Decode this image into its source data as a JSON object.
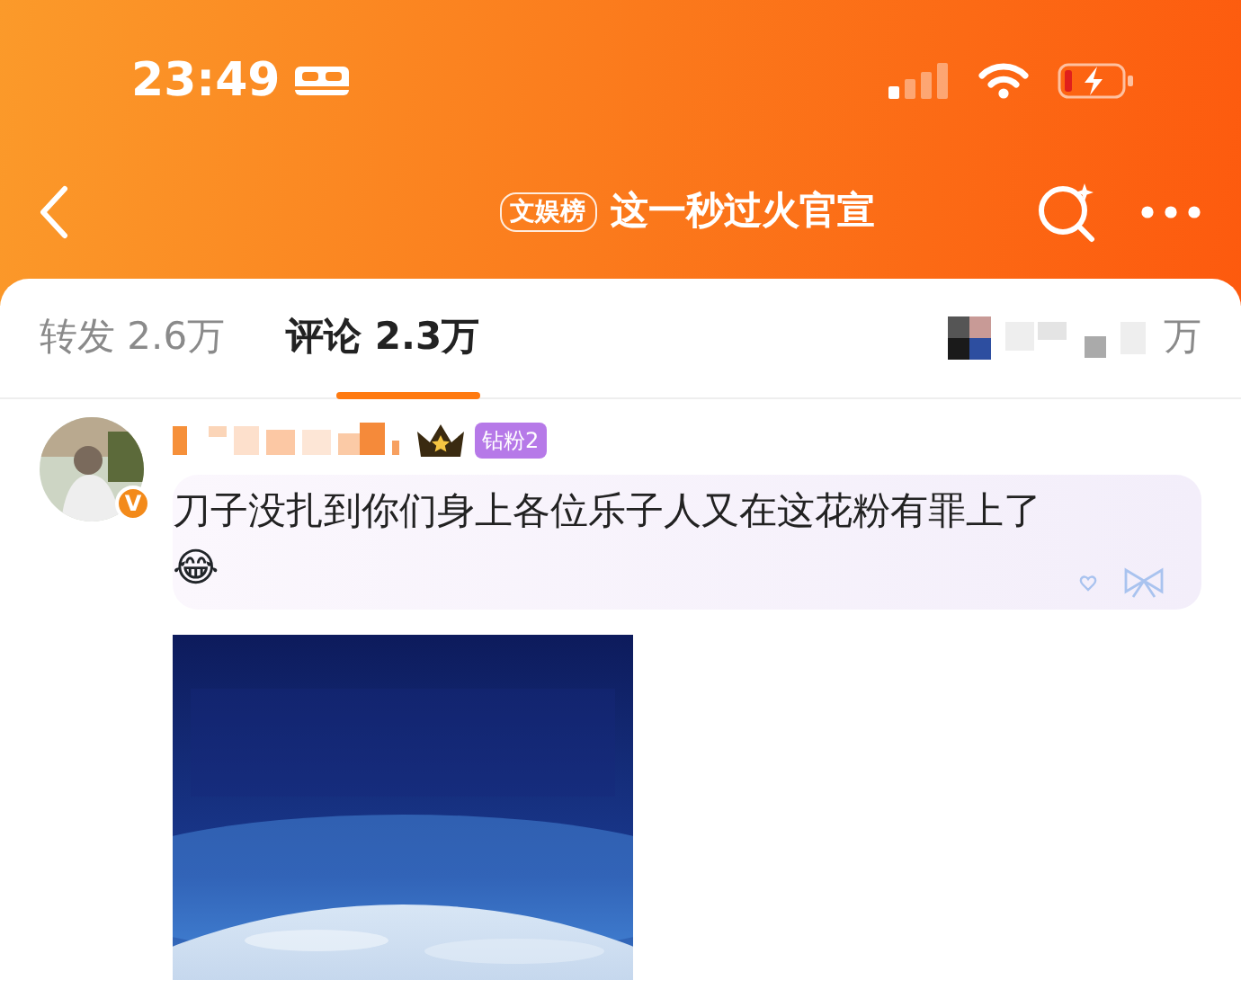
{
  "status_bar": {
    "time": "23:49",
    "battery_charging": true
  },
  "nav": {
    "tag": "文娱榜",
    "title": "这一秒过火官宣"
  },
  "tabs": [
    {
      "kind": "text",
      "label": "转发",
      "count": "2.6万",
      "selected": false
    },
    {
      "kind": "text",
      "label": "评论",
      "count": "2.3万",
      "selected": true
    },
    {
      "kind": "obscured",
      "count": "万",
      "selected": false
    }
  ],
  "comment": {
    "verified_mark": "V",
    "fan_badge": "钻粉2",
    "text": "刀子没扎到你们身上各位乐子人又在这花粉有罪上了",
    "emoji": "😂"
  }
}
